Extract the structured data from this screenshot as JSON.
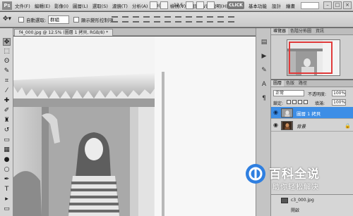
{
  "menubar": {
    "logo": "Ps",
    "items": [
      "文件(F)",
      "編輯(E)",
      "影像(I)",
      "圖層(L)",
      "選取(S)",
      "濾鏡(T)",
      "分析(A)",
      "3D(D)",
      "檢視(V)",
      "視窗(W)",
      "說明(H)"
    ],
    "zoom": "12.5",
    "click_button": "CLICK",
    "workspaces": [
      "基本功能",
      "設計",
      "繪畫"
    ]
  },
  "options": {
    "auto_select_label": "自動選取:",
    "auto_select_value": "群組",
    "show_transform_label": "顯示變形控制項"
  },
  "document": {
    "tab_title": "f4_000.jpg @ 12.5% (圖層 1 拷貝, RGB/8) *"
  },
  "navigator": {
    "tabs": [
      "導覽器",
      "色階分佈圖",
      "資訊"
    ]
  },
  "layers": {
    "tabs": [
      "圖層",
      "色版",
      "路徑"
    ],
    "blend_mode": "正常",
    "opacity_label": "不透明度:",
    "opacity_value": "100%",
    "lock_label": "鎖定:",
    "fill_label": "填滿:",
    "fill_value": "100%",
    "items": [
      {
        "name": "圖層 1 拷貝",
        "selected": true
      },
      {
        "name": "背景",
        "selected": false
      }
    ]
  },
  "lower": {
    "items": [
      "c3_000.jpg",
      "開啟"
    ]
  },
  "watermark": {
    "title": "百科全说",
    "subtitle": "助你轻松解决"
  },
  "colors": {
    "selection": "#3d8ee6",
    "nav_frame": "#e03a3a",
    "watermark_blue": "#2f7fe0"
  }
}
